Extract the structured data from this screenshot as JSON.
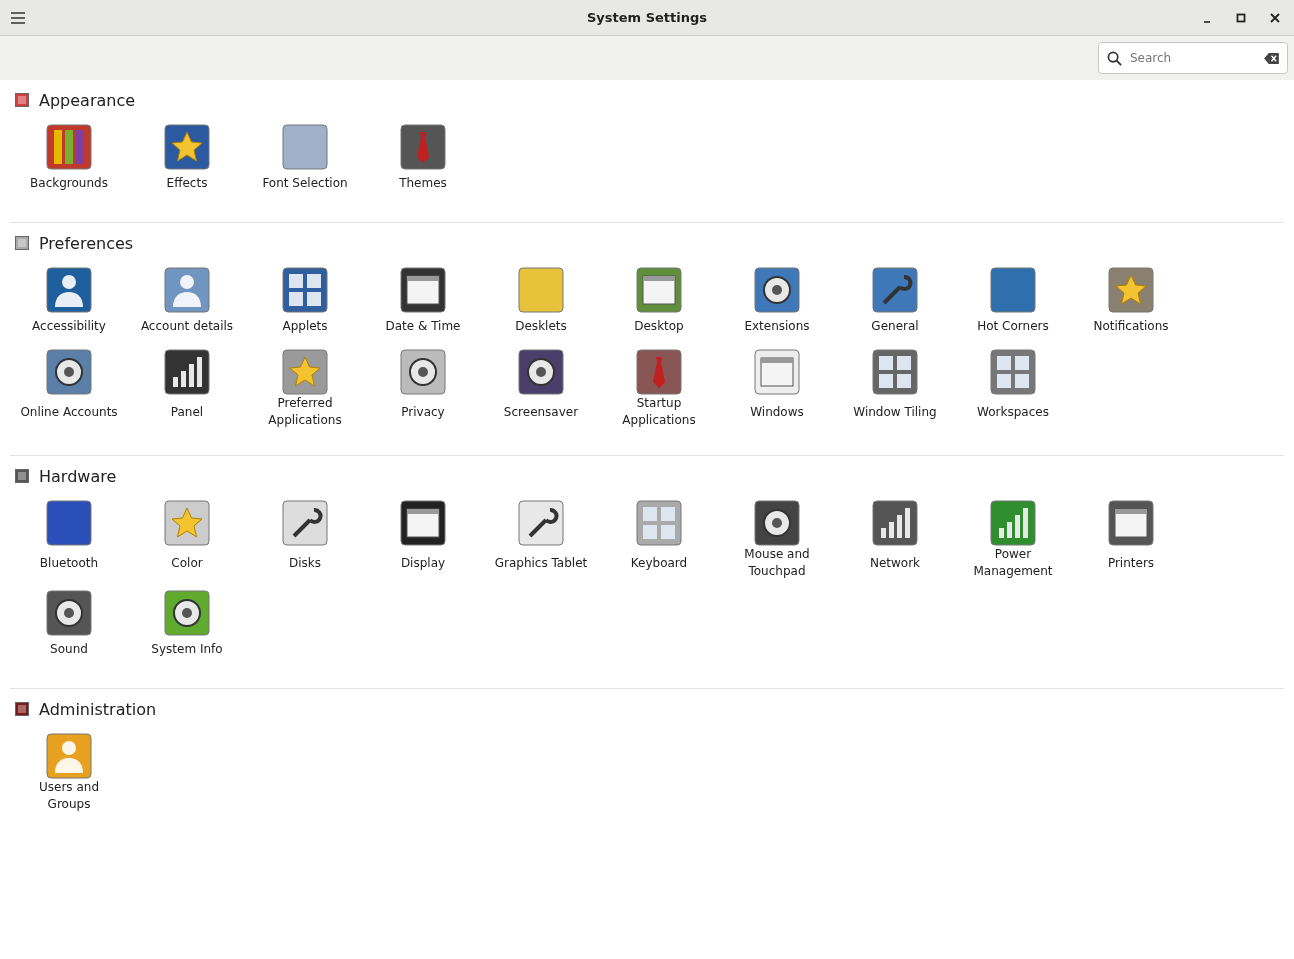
{
  "window": {
    "title": "System Settings"
  },
  "search": {
    "placeholder": "Search"
  },
  "sections": [
    {
      "title": "Appearance",
      "rows": [
        [
          "Backgrounds",
          "Effects",
          "Font Selection",
          "Themes"
        ]
      ]
    },
    {
      "title": "Preferences",
      "rows": [
        [
          "Accessibility",
          "Account details",
          "Applets",
          "Date & Time",
          "Desklets",
          "Desktop",
          "Extensions",
          "General",
          "Hot Corners",
          "Notifications"
        ],
        [
          "Online Accounts",
          "Panel",
          "Preferred\nApplications",
          "Privacy",
          "Screensaver",
          "Startup\nApplications",
          "Windows",
          "Window Tiling",
          "Workspaces"
        ]
      ]
    },
    {
      "title": "Hardware",
      "rows": [
        [
          "Bluetooth",
          "Color",
          "Disks",
          "Display",
          "Graphics Tablet",
          "Keyboard",
          "Mouse and\nTouchpad",
          "Network",
          "Power\nManagement",
          "Printers"
        ],
        [
          "Sound",
          "System Info"
        ]
      ]
    },
    {
      "title": "Administration",
      "rows": [
        [
          "Users and\nGroups"
        ]
      ]
    }
  ]
}
